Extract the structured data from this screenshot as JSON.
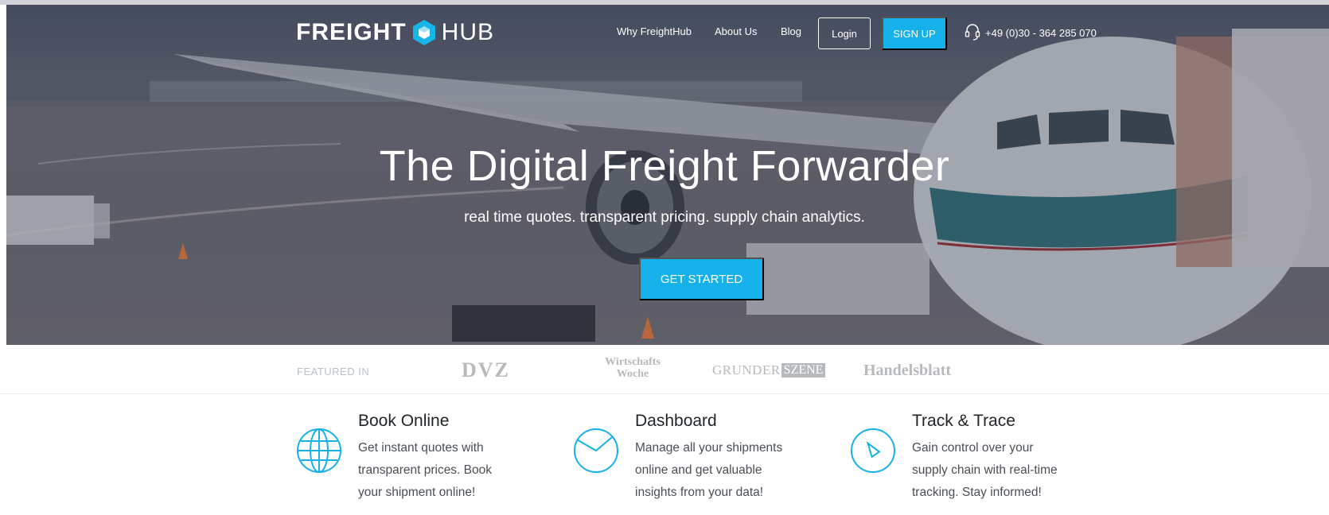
{
  "brand": {
    "logo_left": "FREIGHT",
    "logo_right": "HUB",
    "logo_icon": "hexagon-cube-icon"
  },
  "nav": {
    "items": [
      "Why FreightHub",
      "About Us",
      "Blog"
    ],
    "login_label": "Login",
    "signup_label": "SIGN UP",
    "phone_icon": "headset-icon",
    "phone": "+49 (0)30 - 364 285 070"
  },
  "hero": {
    "title": "The Digital Freight Forwarder",
    "subtitle": "real time quotes. transparent pricing. supply chain analytics.",
    "cta_label": "GET STARTED"
  },
  "featured": {
    "label": "FEATURED IN",
    "logos": {
      "dvz": "DVZ",
      "wiwo_line1": "Wirtschafts",
      "wiwo_line2": "Woche",
      "gruenderszene_a": "GRUNDER",
      "gruenderszene_b": "SZENE",
      "handelsblatt": "Handelsblatt"
    }
  },
  "features": [
    {
      "icon": "globe-icon",
      "title": "Book Online",
      "text": "Get instant quotes with transparent prices. Book your shipment online!"
    },
    {
      "icon": "pie-chart-icon",
      "title": "Dashboard",
      "text": "Manage all your shipments online and get valuable insights from your data!"
    },
    {
      "icon": "compass-icon",
      "title": "Track & Trace",
      "text": "Gain control over your supply chain with real-time tracking. Stay informed!"
    }
  ],
  "colors": {
    "accent": "#16b1ea",
    "title_text": "#1f2428",
    "body_text": "#4a4f55",
    "muted": "#b7babd"
  }
}
